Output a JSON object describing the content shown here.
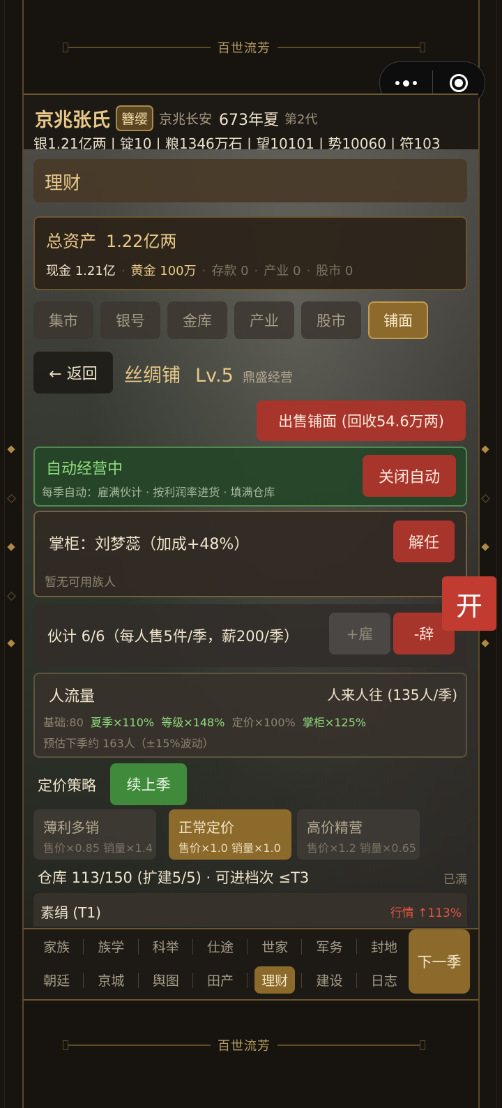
{
  "deco_title": "百世流芳",
  "header": {
    "clan": "京兆张氏",
    "badge": "簪缨",
    "location": "京兆长安",
    "year": "673年夏",
    "generation": "第2代",
    "stats": "银1.21亿两 | 锭10 | 粮1346万石 | 望10101 | 势10060 | 符103"
  },
  "section_title": "理财",
  "assets": {
    "total_label": "总资产",
    "total_value": "1.22亿两",
    "cash": "现金 1.21亿",
    "gold": "黄金 100万",
    "deposit": "存款 0",
    "industry": "产业 0",
    "stocks": "股市 0",
    "separator": "·"
  },
  "tabs": [
    "集市",
    "银号",
    "金库",
    "产业",
    "股市",
    "铺面"
  ],
  "active_tab": "铺面",
  "shop": {
    "back_label": "← 返回",
    "name": "丝绸铺",
    "level": "Lv.5",
    "status": "鼎盛经营",
    "sell_label": "出售铺面 (回收54.6万两)"
  },
  "auto": {
    "title": "自动经营中",
    "desc": "每季自动：雇满伙计 · 按利润率进货 · 填满仓库",
    "toggle_label": "关闭自动"
  },
  "manager": {
    "text": "掌柜：刘梦蕊（加成+48%）",
    "dismiss_label": "解任",
    "note": "暂无可用族人"
  },
  "staff": {
    "text": "伙计 6/6（每人售5件/季，薪200/季）",
    "hire_label": "+雇",
    "fire_label": "-辞"
  },
  "traffic": {
    "title": "人流量",
    "value": "人来人往 (135人/季)",
    "base": "基础:80",
    "season": "夏季×110%",
    "level": "等级×148%",
    "price": "定价×100%",
    "manager": "掌柜×125%",
    "estimate": "预估下季约 163人（±15%波动）"
  },
  "pricing": {
    "label": "定价策略",
    "continue_label": "续上季",
    "options": [
      {
        "name": "薄利多销",
        "detail": "售价×0.85 销量×1.4"
      },
      {
        "name": "正常定价",
        "detail": "售价×1.0 销量×1.0"
      },
      {
        "name": "高价精营",
        "detail": "售价×1.2 销量×0.65"
      }
    ],
    "selected": "正常定价"
  },
  "warehouse": {
    "text": "仓库 113/150 (扩建5/5) · 可进档次 ≤T3",
    "status": "已满",
    "item_name": "素绢 (T1)",
    "item_market": "行情 ↑113%"
  },
  "nav": {
    "row1": [
      "家族",
      "族学",
      "科举",
      "仕途",
      "世家",
      "军务",
      "封地"
    ],
    "row2": [
      "朝廷",
      "京城",
      "舆图",
      "田产",
      "理财",
      "建设",
      "日志"
    ],
    "active": "理财",
    "next_label": "下一季"
  },
  "float_button": "开",
  "colors": {
    "gold": "#e8c98a",
    "red_button": "#a8352c",
    "green_button": "#3f8a3b",
    "active_tab": "#8c6a2c"
  }
}
